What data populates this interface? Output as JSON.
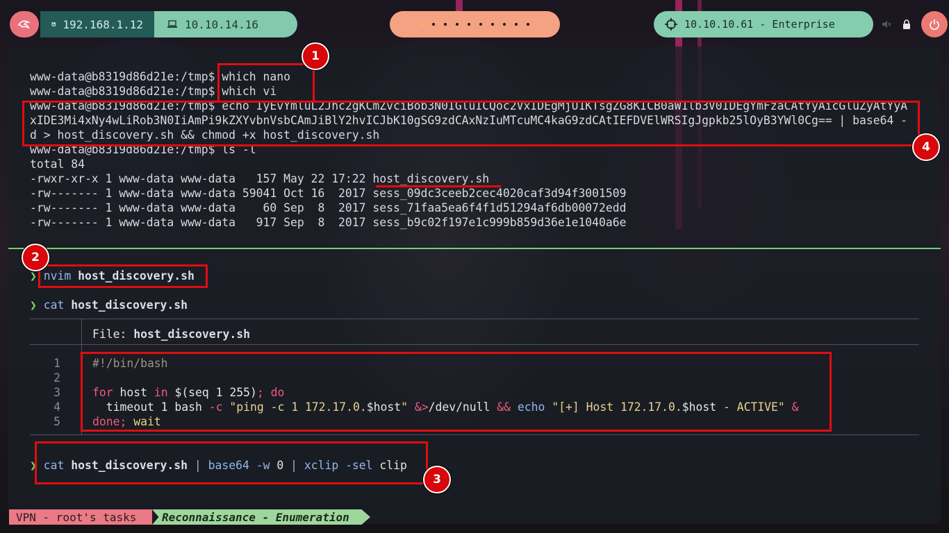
{
  "topbar": {
    "ip_local": "192.168.1.12",
    "ip_vpn": "10.10.14.16",
    "target": "10.10.10.61 - Enterprise",
    "workspaces": 10,
    "active_workspace": 1
  },
  "terminal": {
    "remote_lines": [
      "www-data@b8319d86d21e:/tmp$ which nano",
      "www-data@b8319d86d21e:/tmp$ which vi",
      "www-data@b8319d86d21e:/tmp$ echo IyEvYmluL2Jhc2gKCmZvciBob3N0IGluICQoc2VxIDEgMjU1KTsgZG8KICB0aW1lb3V0IDEgYmFzaCAtYyAicGluZyAtYyA",
      "xIDE3Mi4xNy4wLiRob3N0IiAmPi9kZXYvbnVsbCAmJiBlY2hvICJbK10gSG9zdCAxNzIuMTcuMC4kaG9zdCAtIEFDVElWRSIgJgpkb25lOyB3YWl0Cg== | base64 -",
      "d > host_discovery.sh && chmod +x host_discovery.sh",
      "www-data@b8319d86d21e:/tmp$ ls -l",
      "total 84",
      "-rwxr-xr-x 1 www-data www-data   157 May 22 17:22 host_discovery.sh",
      "-rw------- 1 www-data www-data 59041 Oct 16  2017 sess_09dc3ceeb2cec4020caf3d94f3001509",
      "-rw------- 1 www-data www-data    60 Sep  8  2017 sess_71faa5ea6f4f1d51294af6db00072edd",
      "-rw------- 1 www-data www-data   917 Sep  8  2017 sess_b9c02f197e1c999b859d36e1e1040a6e"
    ],
    "prompt_symbol": "❯",
    "cmd1": {
      "bin": "nvim",
      "arg": "host_discovery.sh"
    },
    "cmd2": {
      "bin": "cat",
      "arg": "host_discovery.sh"
    },
    "bat_header_label": "File: ",
    "bat_header_file": "host_discovery.sh",
    "line_numbers": [
      "1",
      "2",
      "3",
      "4",
      "5"
    ],
    "cmd3": {
      "bin": "cat",
      "arg": "host_discovery.sh",
      "pipe1": "|",
      "bin2": "base64",
      "flag2": "-w",
      "arg2": "0",
      "pipe2": "|",
      "bin3": "xclip",
      "flag3": "-sel",
      "arg3": "clip"
    },
    "code": {
      "l1": "#!/bin/bash",
      "l3_for": "for",
      "l3_host": " host ",
      "l3_in": "in",
      "l3_rest": " $(seq 1 255)",
      "l3_semi": ";",
      "l3_do": " do",
      "l4_indent": "  timeout 1 bash ",
      "l4_c": "-c",
      "l4_sp": " ",
      "l4_str1": "\"ping -c 1 172.17.0.",
      "l4_var1": "$host",
      "l4_strq": "\"",
      "l4_redir": " &>",
      "l4_null": "/dev/null ",
      "l4_and": "&&",
      "l4_sp2": " ",
      "l4_echo": "echo",
      "l4_sp3": " ",
      "l4_str2": "\"[+] Host 172.17.0.",
      "l4_var2": "$host",
      "l4_str3": " - ACTIVE\"",
      "l4_bg": " &",
      "l5_done": "done",
      "l5_semi": ";",
      "l5_wait": " wait"
    }
  },
  "annotations": [
    "1",
    "2",
    "3",
    "4"
  ],
  "status": {
    "left": "VPN - root's tasks",
    "right": "Reconnaissance - Enumeration"
  }
}
